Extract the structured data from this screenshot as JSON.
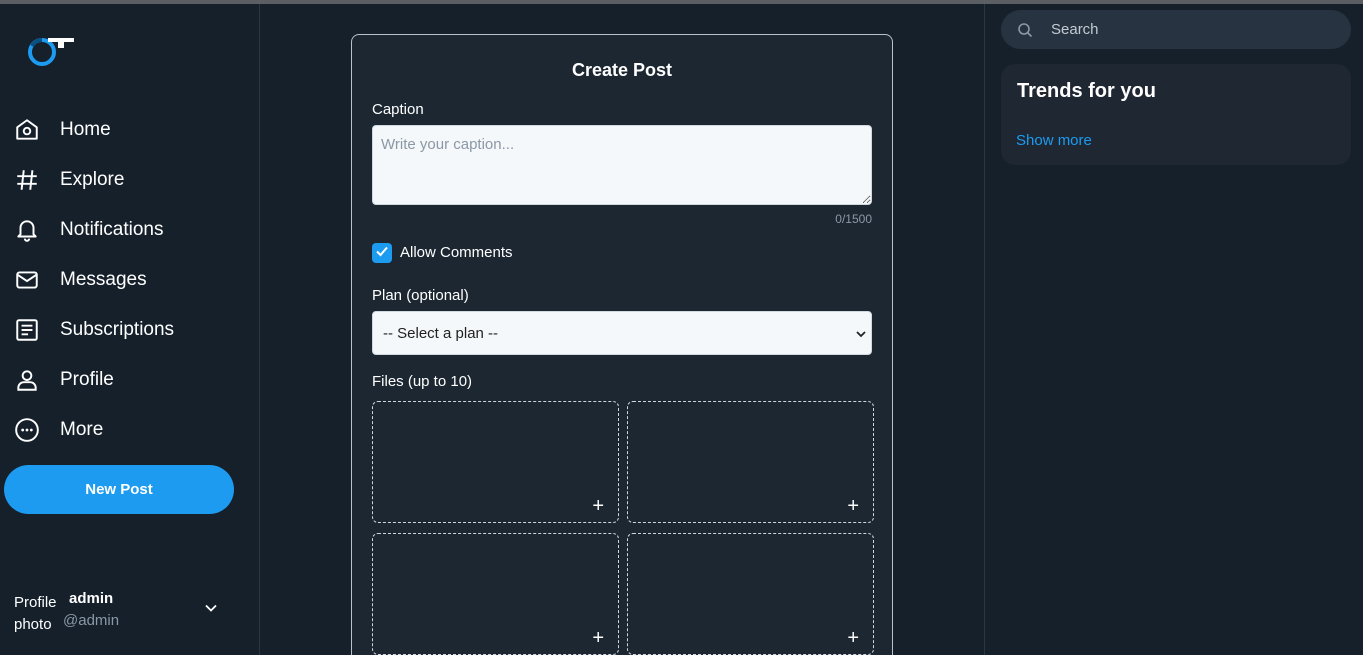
{
  "sidebar": {
    "items": [
      {
        "label": "Home",
        "icon": "home-icon"
      },
      {
        "label": "Explore",
        "icon": "hash-icon"
      },
      {
        "label": "Notifications",
        "icon": "bell-icon"
      },
      {
        "label": "Messages",
        "icon": "mail-icon"
      },
      {
        "label": "Subscriptions",
        "icon": "document-icon"
      },
      {
        "label": "Profile",
        "icon": "user-icon"
      },
      {
        "label": "More",
        "icon": "more-icon"
      }
    ],
    "new_post_label": "New Post",
    "user": {
      "avatar_alt": "Profile photo",
      "name": "admin",
      "handle": "@admin"
    }
  },
  "form": {
    "title": "Create Post",
    "caption_label": "Caption",
    "caption_placeholder": "Write your caption...",
    "counter": "0/1500",
    "allow_comments_label": "Allow Comments",
    "allow_comments_checked": true,
    "plan_label": "Plan (optional)",
    "plan_selected": "-- Select a plan --",
    "files_label": "Files (up to 10)",
    "file_slot_symbol": "+"
  },
  "right": {
    "search_placeholder": "Search",
    "trends_title": "Trends for you",
    "show_more": "Show more"
  },
  "colors": {
    "background": "#15202b",
    "accent": "#1d9bf0",
    "muted": "#8b98a5"
  }
}
